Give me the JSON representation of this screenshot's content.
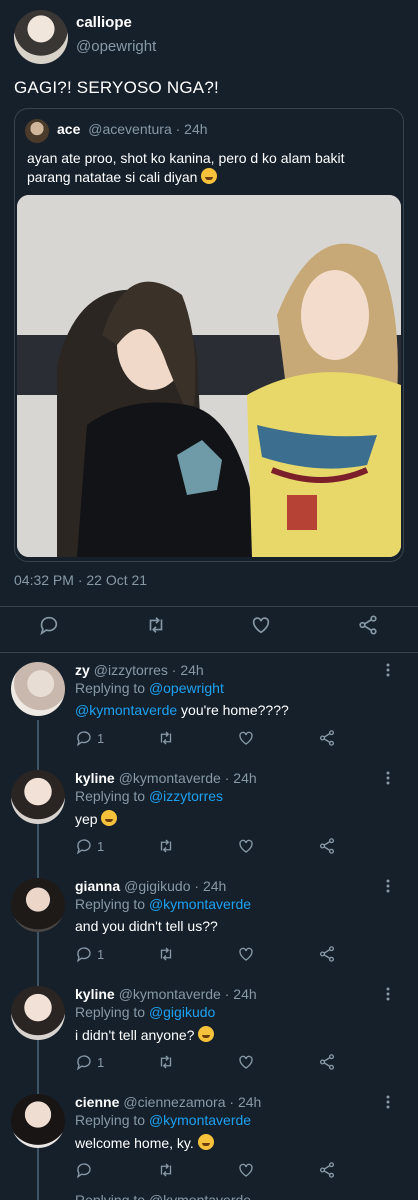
{
  "main_tweet": {
    "name": "calliope",
    "handle": "@opewright",
    "text": "GAGI?! SERYOSO NGA?!",
    "timestamp": "04:32 PM · 22 Oct 21",
    "quote": {
      "name": "ace",
      "handle": "@aceventura",
      "time": "· 24h",
      "text": "ayan ate proo, shot ko kanina, pero d ko alam bakit parang natatae si cali diyan",
      "emoji": "grinning-sweat-emoji"
    }
  },
  "replies": [
    {
      "name": "zy",
      "handle": "@izzytorres",
      "time": "· 24h",
      "replying_prefix": "Replying to",
      "replying_to": "@opewright",
      "mention": "@kymontaverde",
      "text": " you're home????",
      "reply_count": "1"
    },
    {
      "name": "kyline",
      "handle": "@kymontaverde",
      "time": "· 24h",
      "replying_prefix": "Replying to",
      "replying_to": "@izzytorres",
      "mention": "",
      "text": "yep",
      "reply_count": "1"
    },
    {
      "name": "gianna",
      "handle": "@gigikudo",
      "time": "· 24h",
      "replying_prefix": "Replying to",
      "replying_to": "@kymontaverde",
      "mention": "",
      "text": "and you didn't tell us??",
      "reply_count": "1"
    },
    {
      "name": "kyline",
      "handle": "@kymontaverde",
      "time": "· 24h",
      "replying_prefix": "Replying to",
      "replying_to": "@gigikudo",
      "mention": "",
      "text": "i didn't tell anyone?",
      "reply_count": "1"
    },
    {
      "name": "cienne",
      "handle": "@ciennezamora",
      "time": "· 24h",
      "replying_prefix": "Replying to",
      "replying_to": "@kymontaverde",
      "mention": "",
      "text": "welcome home, ky.",
      "reply_count": ""
    }
  ],
  "cutoff": {
    "text": "Replying to @kymontaverde"
  },
  "colors": {
    "background": "#15202b",
    "accent": "#1da1f2",
    "muted": "#8899a6",
    "border": "#38444d"
  }
}
